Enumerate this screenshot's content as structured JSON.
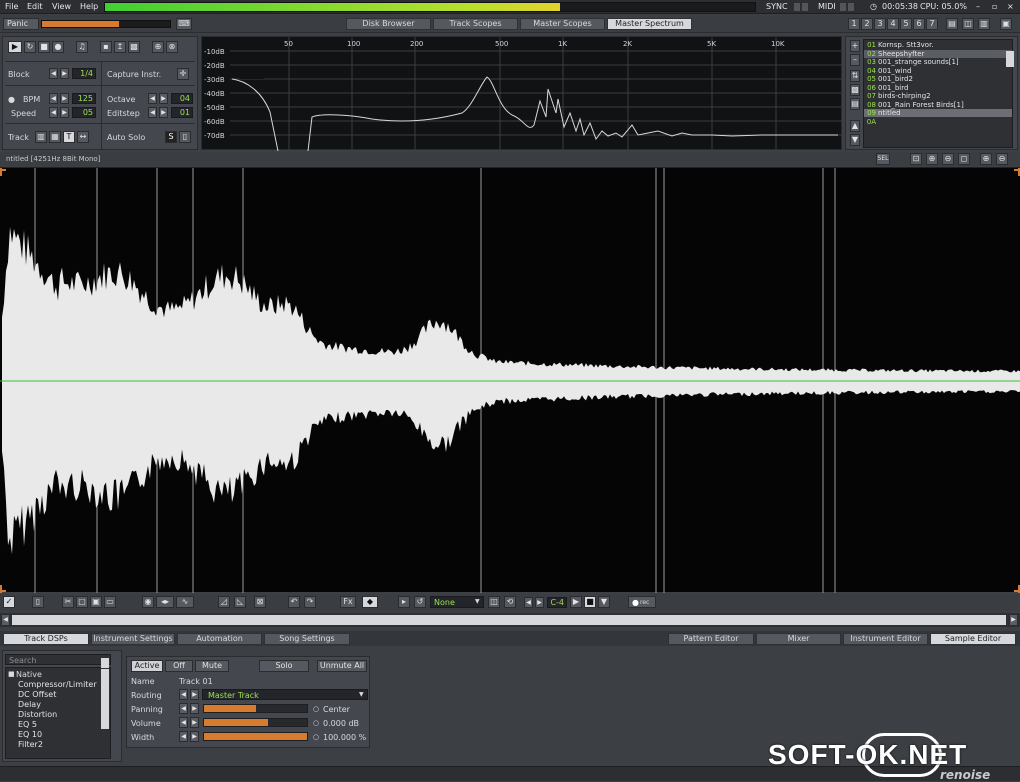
{
  "menu": [
    "File",
    "Edit",
    "View",
    "Help"
  ],
  "status": {
    "sync": "SYNC",
    "midi": "MIDI",
    "time": "00:05:38",
    "cpu": "CPU: 05.0%"
  },
  "panic_label": "Panic",
  "top_tabs": [
    "Disk Browser",
    "Track Scopes",
    "Master Scopes",
    "Master Spectrum"
  ],
  "top_tabs_active": 3,
  "number_buttons": [
    "1",
    "2",
    "3",
    "4",
    "5",
    "6",
    "7"
  ],
  "controls": {
    "block_label": "Block",
    "block_value": "1/4",
    "capture_label": "Capture Instr.",
    "bpm_label": "BPM",
    "bpm_value": "125",
    "speed_label": "Speed",
    "speed_value": "05",
    "octave_label": "Octave",
    "octave_value": "04",
    "editstep_label": "Editstep",
    "editstep_value": "01",
    "track_label": "Track",
    "autosolo_label": "Auto Solo",
    "autosolo_value": "S"
  },
  "spectrum": {
    "freq_labels": [
      "50",
      "100",
      "200",
      "500",
      "1K",
      "2K",
      "5K",
      "10K"
    ],
    "db_labels": [
      "-10dB",
      "-20dB",
      "-30dB",
      "-40dB",
      "-50dB",
      "-60dB",
      "-70dB"
    ]
  },
  "instruments": [
    {
      "n": "01",
      "name": "Kornsp. Stt3vor."
    },
    {
      "n": "02",
      "name": "Sheepshyfter"
    },
    {
      "n": "03",
      "name": "001_strange sounds[1]"
    },
    {
      "n": "04",
      "name": "001_wind"
    },
    {
      "n": "05",
      "name": "001_bird2"
    },
    {
      "n": "06",
      "name": "001_bird"
    },
    {
      "n": "07",
      "name": "birds-chirping2"
    },
    {
      "n": "08",
      "name": "001_Rain Forest Birds[1]"
    },
    {
      "n": "09",
      "name": "ntitled"
    },
    {
      "n": "0A",
      "name": ""
    }
  ],
  "instruments_selected": 8,
  "sample_title": "ntitled [4251Hz 8Bit Mono]",
  "sample_toolbar": {
    "none_label": "None",
    "note_value": "C-4",
    "rec_label": "rec"
  },
  "bottom_tabs_left": [
    "Track DSPs",
    "Instrument Settings",
    "Automation",
    "Song Settings"
  ],
  "bottom_tabs_left_active": 0,
  "bottom_tabs_right": [
    "Pattern Editor",
    "Mixer",
    "Instrument Editor",
    "Sample Editor"
  ],
  "bottom_tabs_right_active": 3,
  "dsp_search_placeholder": "Search",
  "dsp_root": "Native",
  "dsp_list": [
    "Compressor/Limiter",
    "DC Offset",
    "Delay",
    "Distortion",
    "EQ 5",
    "EQ 10",
    "Filter2"
  ],
  "track_panel": {
    "active_label": "Active",
    "off_label": "Off",
    "mute_label": "Mute",
    "solo_label": "Solo",
    "unmute_all_label": "Unmute All",
    "name_label": "Name",
    "name_value": "Track 01",
    "routing_label": "Routing",
    "routing_value": "Master Track",
    "panning_label": "Panning",
    "panning_value": "Center",
    "panning_level": 0.5,
    "volume_label": "Volume",
    "volume_value": "0.000 dB",
    "volume_level": 0.62,
    "width_label": "Width",
    "width_value": "100.000 %",
    "width_level": 1.0
  },
  "watermark": "SOFT-OK.NET",
  "brand": "renoise",
  "colors": {
    "accent": "#d77b2e",
    "value": "#9be34c",
    "waveform": "#e9e9e9",
    "centerline": "#39c139"
  }
}
